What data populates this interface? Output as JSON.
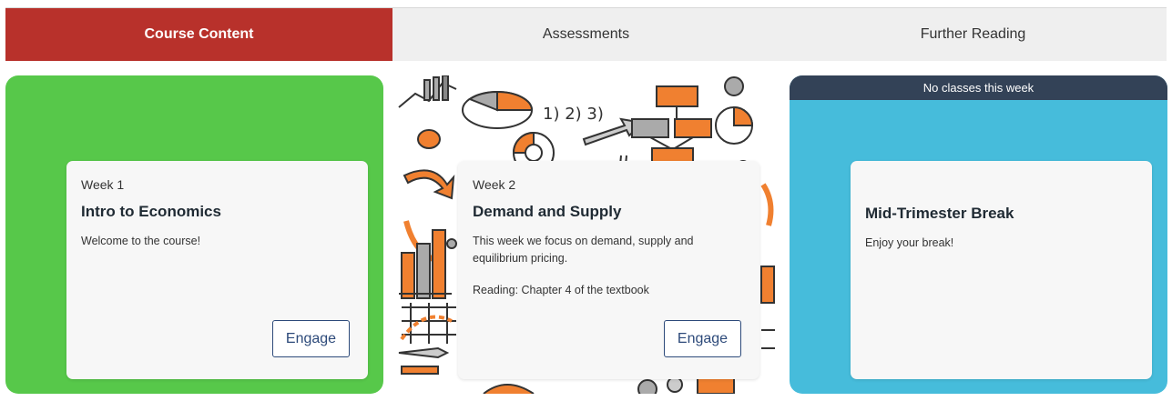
{
  "tabs": [
    {
      "label": "Course Content",
      "active": true
    },
    {
      "label": "Assessments",
      "active": false
    },
    {
      "label": "Further Reading",
      "active": false
    }
  ],
  "colors": {
    "active_tab": "#b8312b",
    "card1_bg": "#57c84a",
    "card3_bg": "#46bcdb",
    "banner_bg": "#334257",
    "doodle_orange": "#f08030",
    "button_border": "#2d4a7a"
  },
  "cards": [
    {
      "week": "Week 1",
      "title": "Intro to Economics",
      "description": "Welcome to the course!",
      "button": "Engage"
    },
    {
      "week": "Week 2",
      "title": "Demand and Supply",
      "description": "This week we focus on demand, supply and equilibrium pricing.",
      "reading": "Reading: Chapter 4 of the textbook",
      "button": "Engage",
      "background": "economics-doodle-pattern"
    },
    {
      "banner": "No classes this week",
      "title": "Mid-Trimester Break",
      "description": "Enjoy your break!"
    }
  ]
}
